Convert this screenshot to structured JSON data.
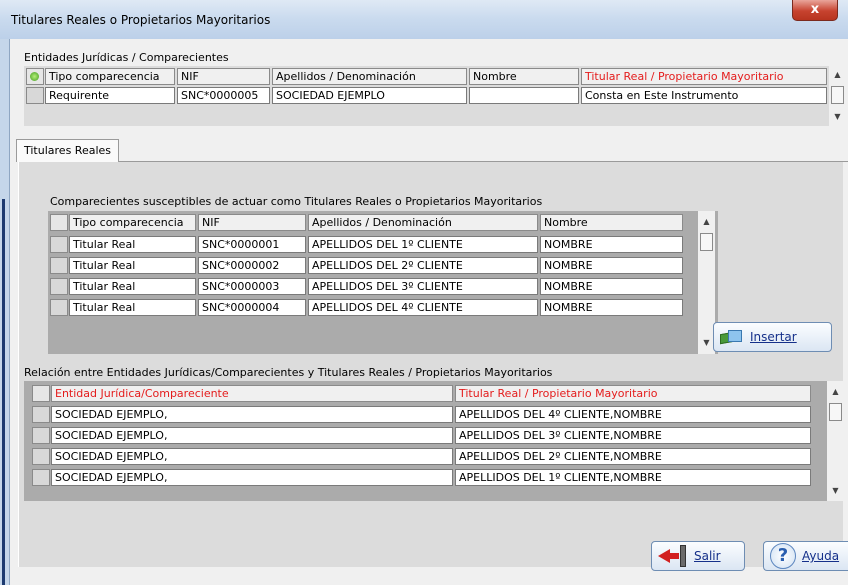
{
  "window": {
    "title": "Titulares Reales  o Propietarios Mayoritarios",
    "close_glyph": "x"
  },
  "entities": {
    "group_title": "Entidades Jurídicas / Comparecientes",
    "columns": [
      "Tipo comparecencia",
      "NIF",
      "Apellidos / Denominación",
      "Nombre",
      "Titular Real / Propietario Mayoritario"
    ],
    "rows": [
      {
        "tipo": "Requirente",
        "nif": "SNC*0000005",
        "apellidos": "SOCIEDAD EJEMPLO",
        "nombre": "",
        "titular": "Consta en Este Instrumento"
      }
    ]
  },
  "tabs": [
    {
      "label": "Titulares Reales",
      "active": true
    }
  ],
  "candidates": {
    "group_title": "Comparecientes susceptibles de actuar como Titulares Reales o  Propietarios Mayoritarios",
    "columns": [
      "Tipo comparecencia",
      "NIF",
      "Apellidos / Denominación",
      "Nombre"
    ],
    "rows": [
      {
        "tipo": "Titular Real",
        "nif": "SNC*0000001",
        "apellidos": "APELLIDOS DEL 1º CLIENTE",
        "nombre": "NOMBRE"
      },
      {
        "tipo": "Titular Real",
        "nif": "SNC*0000002",
        "apellidos": "APELLIDOS DEL 2º CLIENTE",
        "nombre": "NOMBRE"
      },
      {
        "tipo": "Titular Real",
        "nif": "SNC*0000003",
        "apellidos": "APELLIDOS DEL 3º CLIENTE",
        "nombre": "NOMBRE"
      },
      {
        "tipo": "Titular Real",
        "nif": "SNC*0000004",
        "apellidos": "APELLIDOS DEL 4º CLIENTE",
        "nombre": "NOMBRE"
      }
    ]
  },
  "insert_button": {
    "label": "Insertar",
    "icon": "insert-icon"
  },
  "relations": {
    "group_title": "Relación entre Entidades Jurídicas/Comparecientes y Titulares Reales / Propietarios Mayoritarios",
    "columns": [
      "Entidad Jurídica/Compareciente",
      "Titular Real / Propietario Mayoritario"
    ],
    "rows": [
      {
        "entidad": "SOCIEDAD EJEMPLO,",
        "titular": "APELLIDOS DEL 4º CLIENTE,NOMBRE"
      },
      {
        "entidad": "SOCIEDAD EJEMPLO,",
        "titular": "APELLIDOS DEL 3º CLIENTE,NOMBRE"
      },
      {
        "entidad": "SOCIEDAD EJEMPLO,",
        "titular": "APELLIDOS DEL 2º CLIENTE,NOMBRE"
      },
      {
        "entidad": "SOCIEDAD EJEMPLO,",
        "titular": "APELLIDOS DEL 1º CLIENTE,NOMBRE"
      }
    ]
  },
  "footer": {
    "exit_label": "Salir",
    "help_label": "Ayuda"
  },
  "colors": {
    "header_red": "#e41c1c",
    "link_blue": "#15308a",
    "title_gradient": "#c9daee"
  }
}
